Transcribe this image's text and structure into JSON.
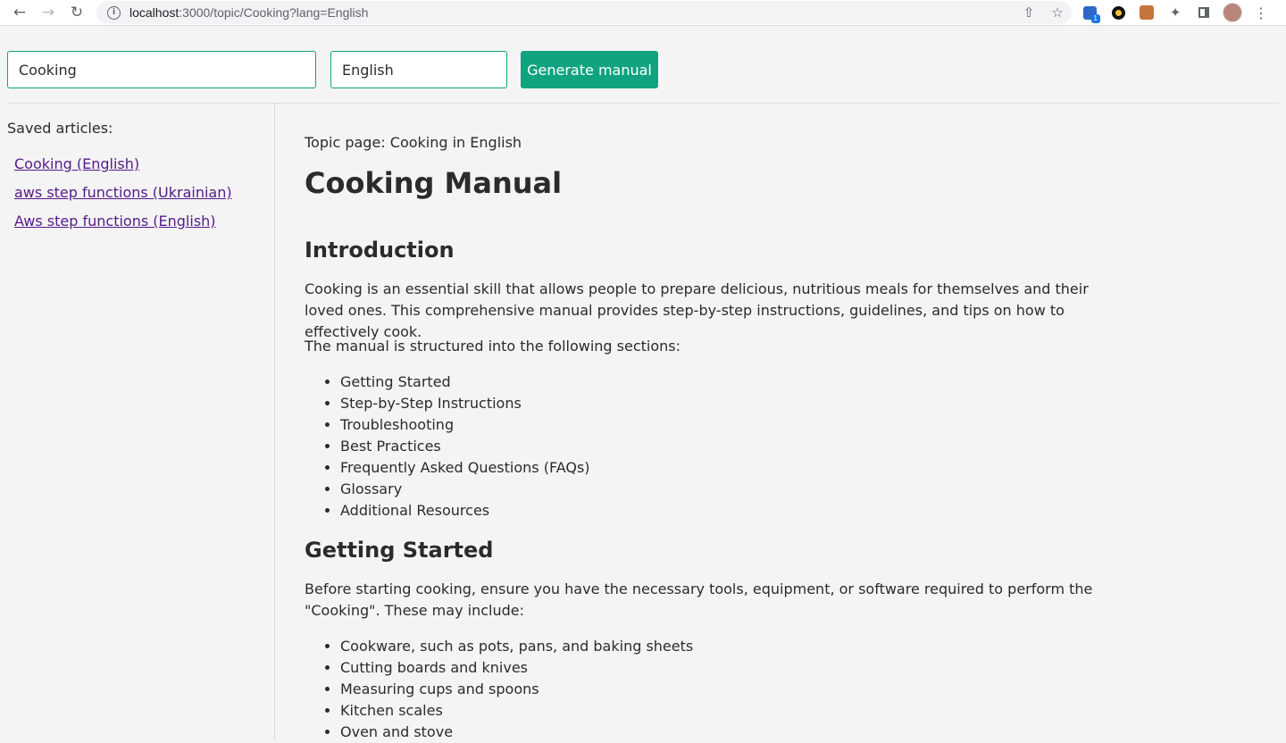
{
  "browser": {
    "url_host": "localhost",
    "url_path": ":3000/topic/Cooking?lang=English",
    "extension_badge": "1"
  },
  "form": {
    "topic_value": "Cooking",
    "language_value": "English",
    "generate_label": "Generate manual"
  },
  "sidebar": {
    "label": "Saved articles:",
    "items": [
      {
        "label": "Cooking (English)"
      },
      {
        "label": "aws step functions (Ukrainian)"
      },
      {
        "label": "Aws step functions (English)"
      }
    ]
  },
  "article": {
    "topic_line": "Topic page: Cooking in English",
    "title": "Cooking Manual",
    "intro_heading": "Introduction",
    "intro_p1": "Cooking is an essential skill that allows people to prepare delicious, nutritious meals for themselves and their loved ones. This comprehensive manual provides step-by-step instructions, guidelines, and tips on how to effectively cook.",
    "intro_p2": "The manual is structured into the following sections:",
    "sections": [
      "Getting Started",
      "Step-by-Step Instructions",
      "Troubleshooting",
      "Best Practices",
      "Frequently Asked Questions (FAQs)",
      "Glossary",
      "Additional Resources"
    ],
    "gs_heading": "Getting Started",
    "gs_p": "Before starting cooking, ensure you have the necessary tools, equipment, or software required to perform the \"Cooking\". These may include:",
    "tools": [
      "Cookware, such as pots, pans, and baking sheets",
      "Cutting boards and knives",
      "Measuring cups and spoons",
      "Kitchen scales",
      "Oven and stove"
    ]
  }
}
